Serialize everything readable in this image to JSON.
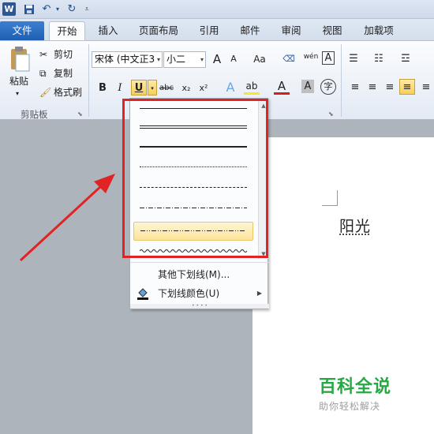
{
  "quick_access": {
    "logo": "W",
    "save_icon": "save-icon",
    "undo_icon": "undo-icon",
    "redo_icon": "redo-icon"
  },
  "tabs": [
    {
      "label": "文件"
    },
    {
      "label": "开始"
    },
    {
      "label": "插入"
    },
    {
      "label": "页面布局"
    },
    {
      "label": "引用"
    },
    {
      "label": "邮件"
    },
    {
      "label": "审阅"
    },
    {
      "label": "视图"
    },
    {
      "label": "加载项"
    }
  ],
  "clipboard": {
    "paste_label": "粘贴",
    "cut_label": "剪切",
    "copy_label": "复制",
    "format_painter_label": "格式刷",
    "group_label": "剪贴板"
  },
  "font": {
    "font_name": "宋体 (中文正3",
    "font_size": "小二",
    "grow_label": "A",
    "shrink_label": "A",
    "case_label": "Aa",
    "bold_label": "B",
    "italic_label": "I",
    "underline_label": "U",
    "strike_label": "abc",
    "subscript_label": "x₂",
    "superscript_label": "x²",
    "color_label": "A",
    "wen_label": "wén",
    "char_border_label": "A",
    "char_shade_label": "A",
    "enclose_label": "字"
  },
  "underline_menu": {
    "more_label": "其他下划线(M)...",
    "color_label": "下划线颜色(U)",
    "styles": [
      "single",
      "double",
      "thick",
      "dotted",
      "dashed",
      "dash-dot",
      "dash-dot-dot",
      "wave"
    ],
    "selected_index": 6
  },
  "document": {
    "text": "阳光"
  },
  "watermark": {
    "title": "百科全说",
    "subtitle": "助你轻松解决"
  },
  "colors": {
    "accent": "#2b5797",
    "annotation": "#e02424",
    "watermark": "#27a844"
  }
}
